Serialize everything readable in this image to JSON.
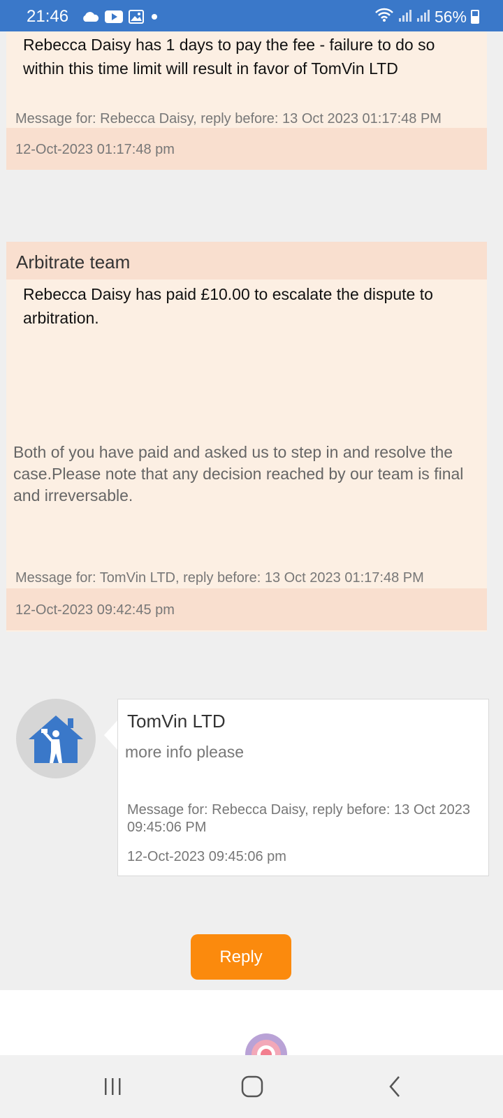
{
  "status_bar": {
    "time": "21:46",
    "battery": "56%",
    "left_icons": [
      "cloud-icon",
      "youtube-icon",
      "gallery-icon",
      "dot-icon"
    ],
    "right_icons": [
      "wifi-icon",
      "signal-icon",
      "signal-icon",
      "battery-icon"
    ],
    "bar_color": "#3a78c9"
  },
  "messages": [
    {
      "body": "Rebecca Daisy has 1 days to pay the fee - failure to do so within this time limit will result in favor of TomVin LTD",
      "meta": "Message for: Rebecca Daisy, reply before: 13 Oct 2023 01:17:48 PM",
      "timestamp": "12-Oct-2023 01:17:48 pm"
    },
    {
      "sender": "Arbitrate team",
      "body": "Rebecca Daisy has paid £10.00 to escalate the dispute to arbitration.",
      "note": "Both of you have paid and asked us to step in and resolve the case.Please note that any decision reached by our team is final and irreversable.",
      "meta": "Message for: TomVin LTD, reply before: 13 Oct 2023 01:17:48 PM",
      "timestamp": "12-Oct-2023 09:42:45 pm"
    },
    {
      "sender": "TomVin LTD",
      "body": "more info please",
      "meta": "Message for: Rebecca Daisy, reply before: 13 Oct 2023 09:45:06 PM",
      "timestamp": "12-Oct-2023 09:45:06 pm",
      "avatar_icon": "house-person-icon"
    }
  ],
  "reply_button": {
    "label": "Reply",
    "color": "#fb8a0d"
  },
  "nav_bar": {
    "buttons": [
      "recent-apps-icon",
      "home-icon",
      "back-icon"
    ]
  },
  "colors": {
    "card_bg": "#fcefe3",
    "card_header": "#f9dfcf",
    "page_bg": "#efefef"
  }
}
